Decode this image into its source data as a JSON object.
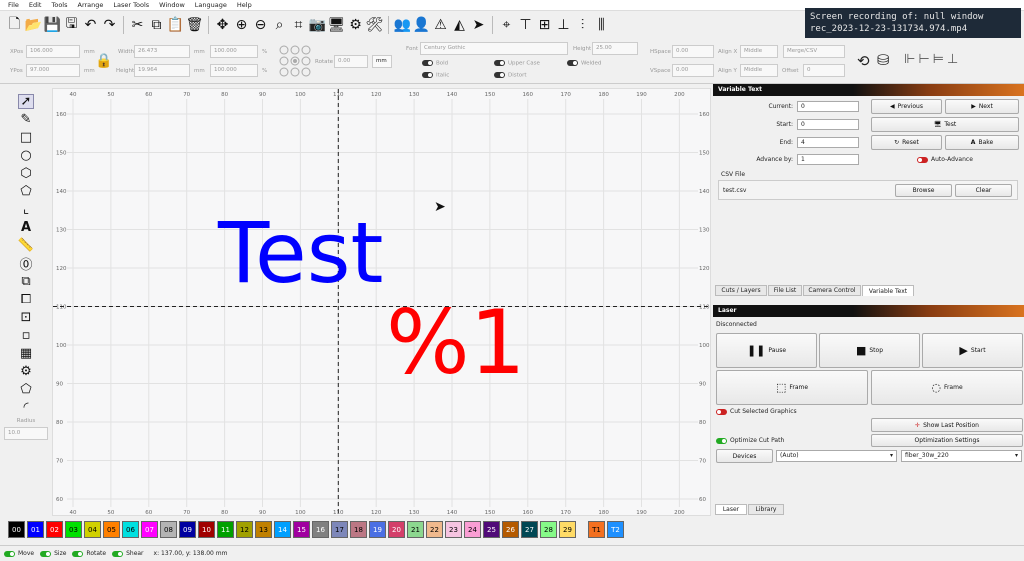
{
  "menu": [
    "File",
    "Edit",
    "Tools",
    "Arrange",
    "Laser Tools",
    "Window",
    "Language",
    "Help"
  ],
  "overlay": {
    "line1": "Screen recording of: null window",
    "line2": "rec_2023-12-23-131734.974.mp4"
  },
  "toolbar2": {
    "xpos_label": "XPos",
    "xpos_value": "106.000",
    "ypos_label": "YPos",
    "ypos_value": "97.000",
    "mm": "mm",
    "width_label": "Width",
    "width_value": "26.473",
    "height_label": "Height",
    "height_value": "19.964",
    "pct1": "100.000",
    "pct2": "100.000",
    "pct_unit": "%",
    "rotate_label": "Rotate",
    "rotate_value": "0.00",
    "mm_button": "mm",
    "font_label": "Font",
    "font_value": "Century Gothic",
    "height2_label": "Height",
    "height2_value": "25.00",
    "bold": "Bold",
    "italic": "Italic",
    "upper_case": "Upper Case",
    "distort": "Distort",
    "welded": "Welded",
    "hspace_label": "HSpace",
    "hspace_value": "0.00",
    "vspace_label": "VSpace",
    "vspace_value": "0.00",
    "alignx_label": "Align X",
    "alignx_value": "Middle",
    "aligny_label": "Align Y",
    "aligny_value": "Middle",
    "merge_value": "Merge/CSV",
    "offset_label": "Offset",
    "offset_value": "0"
  },
  "radius": {
    "label": "Radius",
    "value": "10.0"
  },
  "canvas": {
    "ruler_top": [
      "40",
      "50",
      "60",
      "70",
      "80",
      "90",
      "100",
      "110",
      "120",
      "130",
      "140",
      "150",
      "160",
      "170",
      "180",
      "190",
      "200"
    ],
    "ruler_left": [
      "160",
      "150",
      "140",
      "130",
      "120",
      "110",
      "100",
      "90",
      "80",
      "70",
      "60"
    ],
    "text_blue": "Test",
    "text_red": "%1"
  },
  "variable_text": {
    "title": "Variable Text",
    "current_label": "Current:",
    "current_value": "0",
    "start_label": "Start:",
    "start_value": "0",
    "end_label": "End:",
    "end_value": "4",
    "advance_label": "Advance by:",
    "advance_value": "1",
    "previous": "Previous",
    "next": "Next",
    "test": "Test",
    "reset": "Reset",
    "bake": "Bake",
    "auto_advance": "Auto-Advance",
    "csv_label": "CSV File",
    "csv_file": "test.csv",
    "browse": "Browse",
    "clear": "Clear"
  },
  "tabs": [
    "Cuts / Layers",
    "File List",
    "Camera Control",
    "Variable Text"
  ],
  "laser": {
    "title": "Laser",
    "status": "Disconnected",
    "pause": "Pause",
    "stop": "Stop",
    "start": "Start",
    "frame1": "Frame",
    "frame2": "Frame",
    "cut_selected": "Cut Selected Graphics",
    "show_last": "Show Last Position",
    "optimize_cut": "Optimize Cut Path",
    "optimization_settings": "Optimization Settings",
    "devices": "Devices",
    "device_value": "(Auto)",
    "profile_value": "fiber_30w_220"
  },
  "bottom_tabs": [
    "Laser",
    "Library"
  ],
  "palette": [
    {
      "label": "00",
      "color": "#000000",
      "text": "#ffffff"
    },
    {
      "label": "01",
      "color": "#0000ff",
      "text": "#ffffff"
    },
    {
      "label": "02",
      "color": "#ff0000",
      "text": "#ffffff"
    },
    {
      "label": "03",
      "color": "#00e000",
      "text": "#000000"
    },
    {
      "label": "04",
      "color": "#d0d000",
      "text": "#000000"
    },
    {
      "label": "05",
      "color": "#ff8000",
      "text": "#000000"
    },
    {
      "label": "06",
      "color": "#00e0e0",
      "text": "#000000"
    },
    {
      "label": "07",
      "color": "#ff00ff",
      "text": "#ffffff"
    },
    {
      "label": "08",
      "color": "#b4b4b4",
      "text": "#000000"
    },
    {
      "label": "09",
      "color": "#0000a0",
      "text": "#ffffff"
    },
    {
      "label": "10",
      "color": "#a00000",
      "text": "#ffffff"
    },
    {
      "label": "11",
      "color": "#00a000",
      "text": "#ffffff"
    },
    {
      "label": "12",
      "color": "#a0a000",
      "text": "#000000"
    },
    {
      "label": "13",
      "color": "#c08000",
      "text": "#000000"
    },
    {
      "label": "14",
      "color": "#00a0ff",
      "text": "#ffffff"
    },
    {
      "label": "15",
      "color": "#a000a0",
      "text": "#ffffff"
    },
    {
      "label": "16",
      "color": "#808080",
      "text": "#ffffff"
    },
    {
      "label": "17",
      "color": "#7d87b9",
      "text": "#000000"
    },
    {
      "label": "18",
      "color": "#bb7784",
      "text": "#000000"
    },
    {
      "label": "19",
      "color": "#4a6fe3",
      "text": "#ffffff"
    },
    {
      "label": "20",
      "color": "#d33f6a",
      "text": "#ffffff"
    },
    {
      "label": "21",
      "color": "#8cd78f",
      "text": "#000000"
    },
    {
      "label": "22",
      "color": "#f0b98d",
      "text": "#000000"
    },
    {
      "label": "23",
      "color": "#f6c4e1",
      "text": "#000000"
    },
    {
      "label": "24",
      "color": "#fa9ed4",
      "text": "#000000"
    },
    {
      "label": "25",
      "color": "#500a78",
      "text": "#ffffff"
    },
    {
      "label": "26",
      "color": "#b45a00",
      "text": "#ffffff"
    },
    {
      "label": "27",
      "color": "#004754",
      "text": "#ffffff"
    },
    {
      "label": "28",
      "color": "#86fa88",
      "text": "#000000"
    },
    {
      "label": "29",
      "color": "#ffdb66",
      "text": "#000000"
    },
    {
      "label": "T1",
      "color": "#f37020",
      "text": "#000000"
    },
    {
      "label": "T2",
      "color": "#1e90ff",
      "text": "#ffffff"
    }
  ],
  "status": {
    "move": "Move",
    "size": "Size",
    "rotate": "Rotate",
    "shear": "Shear",
    "coords": "x: 137.00, y: 138.00 mm"
  }
}
